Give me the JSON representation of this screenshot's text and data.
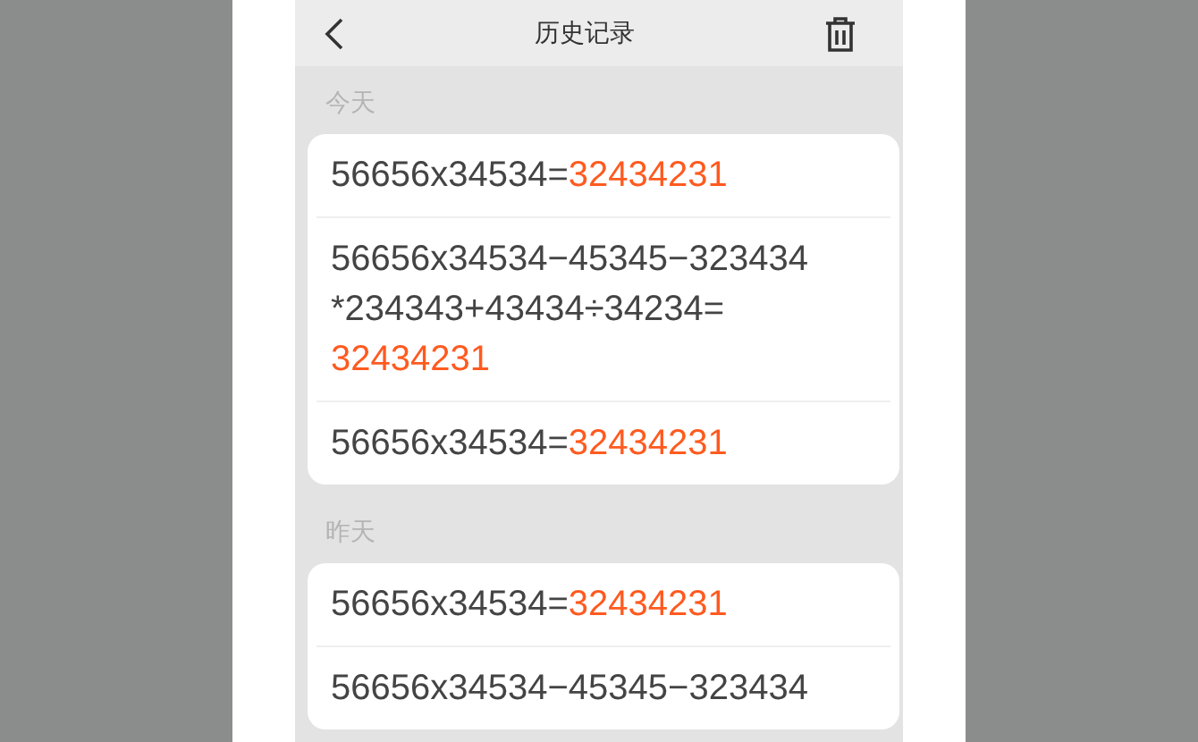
{
  "header": {
    "title": "历史记录"
  },
  "sections": [
    {
      "label": "今天",
      "rows": [
        {
          "lines": [
            {
              "expr": "56656x34534=",
              "result": "32434231"
            }
          ]
        },
        {
          "lines": [
            {
              "expr": "56656x34534−45345−323434"
            },
            {
              "expr": "*234343+43434÷34234="
            },
            {
              "result": "32434231"
            }
          ]
        },
        {
          "lines": [
            {
              "expr": "56656x34534=",
              "result": "32434231"
            }
          ]
        }
      ]
    },
    {
      "label": "昨天",
      "rows": [
        {
          "lines": [
            {
              "expr": "56656x34534=",
              "result": "32434231"
            }
          ]
        },
        {
          "lines": [
            {
              "expr": "56656x34534−45345−323434"
            }
          ]
        }
      ]
    }
  ]
}
